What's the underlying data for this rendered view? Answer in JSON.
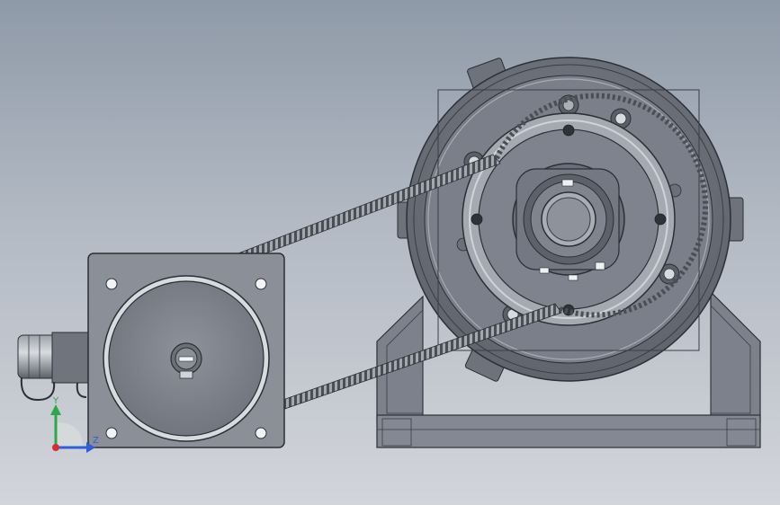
{
  "axis_triad": {
    "y_label": "Y",
    "z_label": "Z",
    "colors": {
      "y": "#2aa84a",
      "z": "#2e5fd6",
      "x": "#d62e2e"
    }
  },
  "colors": {
    "metal_dark": "#5e636d",
    "metal_mid": "#7d828c",
    "metal_light": "#9aa0a9",
    "plate": "#8b8f97",
    "outline": "#2c2f35"
  }
}
